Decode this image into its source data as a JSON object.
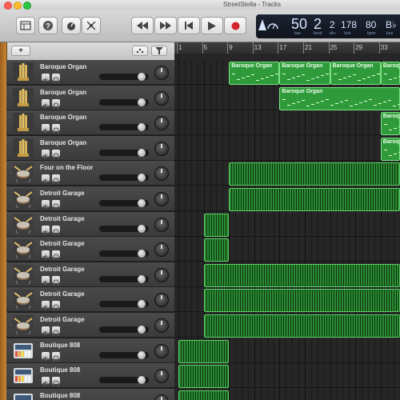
{
  "window": {
    "title": "StreetStella - Tracks"
  },
  "controls": [
    {
      "name": "library-icon"
    },
    {
      "name": "help-icon"
    },
    {
      "name": "smart-controls-icon"
    },
    {
      "name": "editors-icon"
    },
    {
      "name": "rewind-icon"
    },
    {
      "name": "fast-forward-icon"
    },
    {
      "name": "go-to-beginning-icon"
    },
    {
      "name": "play-icon"
    },
    {
      "name": "record-icon"
    }
  ],
  "lcd": {
    "bar": "50",
    "beat": "2",
    "div": "2",
    "tick": "178",
    "tempo": "80",
    "key": "B♭",
    "labels": {
      "bar": "bar",
      "beat": "beat",
      "div": "div",
      "tick": "tick",
      "tempo": "bpm",
      "key": "key"
    }
  },
  "header": {
    "add_label": "+"
  },
  "ruler": {
    "bars": [
      "1",
      "5",
      "9",
      "13",
      "17",
      "21",
      "25",
      "29",
      "33"
    ]
  },
  "tracks": [
    {
      "name": "Baroque Organ",
      "type": "organ",
      "fader": 0.87
    },
    {
      "name": "Baroque Organ",
      "type": "organ",
      "fader": 0.87
    },
    {
      "name": "Baroque Organ",
      "type": "organ",
      "fader": 0.87
    },
    {
      "name": "Baroque Organ",
      "type": "organ",
      "fader": 0.87
    },
    {
      "name": "Four on the Floor",
      "type": "drummer",
      "fader": 0.87
    },
    {
      "name": "Detroit Garage",
      "type": "drummer",
      "fader": 0.87
    },
    {
      "name": "Detroit Garage",
      "type": "drummer",
      "fader": 0.87
    },
    {
      "name": "Detroit Garage",
      "type": "drummer",
      "fader": 0.87
    },
    {
      "name": "Detroit Garage",
      "type": "drummer",
      "fader": 0.87
    },
    {
      "name": "Detroit Garage",
      "type": "drummer",
      "fader": 0.87
    },
    {
      "name": "Detroit Garage",
      "type": "drummer",
      "fader": 0.87
    },
    {
      "name": "Boutique 808",
      "type": "808",
      "fader": 0.87
    },
    {
      "name": "Boutique 808",
      "type": "808",
      "fader": 0.87
    },
    {
      "name": "Boutique 808",
      "type": "808",
      "fader": 0.87
    }
  ],
  "regions": [
    {
      "track": 0,
      "start": 9,
      "end": 17,
      "label": "Baroque Organ",
      "kind": "midi"
    },
    {
      "track": 0,
      "start": 17,
      "end": 25,
      "label": "Baroque Organ",
      "kind": "midi"
    },
    {
      "track": 0,
      "start": 25,
      "end": 33,
      "label": "Baroque Organ",
      "kind": "midi"
    },
    {
      "track": 0,
      "start": 33,
      "end": 38,
      "label": "Baroque Organ",
      "kind": "midi"
    },
    {
      "track": 1,
      "start": 17,
      "end": 38,
      "label": "Baroque Organ",
      "kind": "midi"
    },
    {
      "track": 2,
      "start": 33,
      "end": 38,
      "label": "Baroque Organ",
      "kind": "midi"
    },
    {
      "track": 3,
      "start": 33,
      "end": 38,
      "label": "Baroque Organ",
      "kind": "midi"
    },
    {
      "track": 4,
      "start": 9,
      "end": 38,
      "label": "",
      "kind": "drum"
    },
    {
      "track": 5,
      "start": 9,
      "end": 38,
      "label": "",
      "kind": "drum"
    },
    {
      "track": 6,
      "start": 5,
      "end": 9,
      "label": "",
      "kind": "drum"
    },
    {
      "track": 7,
      "start": 5,
      "end": 9,
      "label": "",
      "kind": "drum"
    },
    {
      "track": 8,
      "start": 5,
      "end": 38,
      "label": "",
      "kind": "drum"
    },
    {
      "track": 9,
      "start": 5,
      "end": 38,
      "label": "",
      "kind": "drum"
    },
    {
      "track": 10,
      "start": 5,
      "end": 38,
      "label": "",
      "kind": "drum"
    },
    {
      "track": 11,
      "start": 1,
      "end": 9,
      "label": "",
      "kind": "drum"
    },
    {
      "track": 12,
      "start": 1,
      "end": 9,
      "label": "",
      "kind": "drum"
    },
    {
      "track": 13,
      "start": 1,
      "end": 9,
      "label": "",
      "kind": "drum"
    }
  ]
}
